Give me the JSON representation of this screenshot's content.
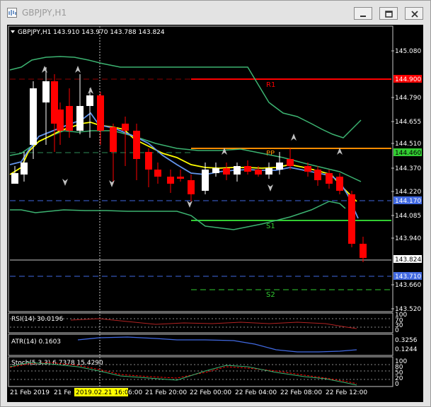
{
  "window": {
    "title": "GBPJPY,H1"
  },
  "chart": {
    "header": "GBPJPY,H1  143.910 143.970 143.788 143.824",
    "price_ticks": [
      "145.080",
      "144.790",
      "144.655",
      "144.510",
      "144.370",
      "144.220",
      "144.085",
      "143.940",
      "143.660",
      "143.520"
    ],
    "levels": {
      "r1": {
        "label": "R1",
        "value": "144.900"
      },
      "pp": {
        "label": "PP",
        "value": "144.460"
      },
      "s1": {
        "label": "S1",
        "value": "144.085"
      },
      "s2": {
        "label": "S2",
        "value": ""
      },
      "blue_upper": "144.170",
      "blue_lower": "143.710",
      "current": "143.824"
    },
    "time_labels": [
      "21 Feb 2019",
      "21 Fe",
      "2019.02.21 16:00",
      "6:00",
      "21 Feb 20:00",
      "22 Feb 00:00",
      "22 Feb 04:00",
      "22 Feb 08:00",
      "22 Feb 12:00"
    ],
    "colors": {
      "bull": "#ffffff",
      "bear": "#ff0000",
      "ema_fast": "#ffff00",
      "ema_slow": "#6495ed",
      "bands": "#3cb371",
      "r1": "#ff0000",
      "pp": "#ff8c00",
      "s": "#32cd32"
    }
  },
  "rsi": {
    "label": "RSI(14) 30.0196",
    "ticks": [
      "100",
      "70",
      "30",
      "0"
    ]
  },
  "atr": {
    "label": "ATR(14) 0.1603",
    "ticks": [
      "0.3256",
      "0.1244"
    ]
  },
  "stoch": {
    "label": "Stoch(5,3,3) 6.7378 15.4290",
    "ticks": [
      "100",
      "80",
      "50",
      "20",
      "0"
    ]
  }
}
